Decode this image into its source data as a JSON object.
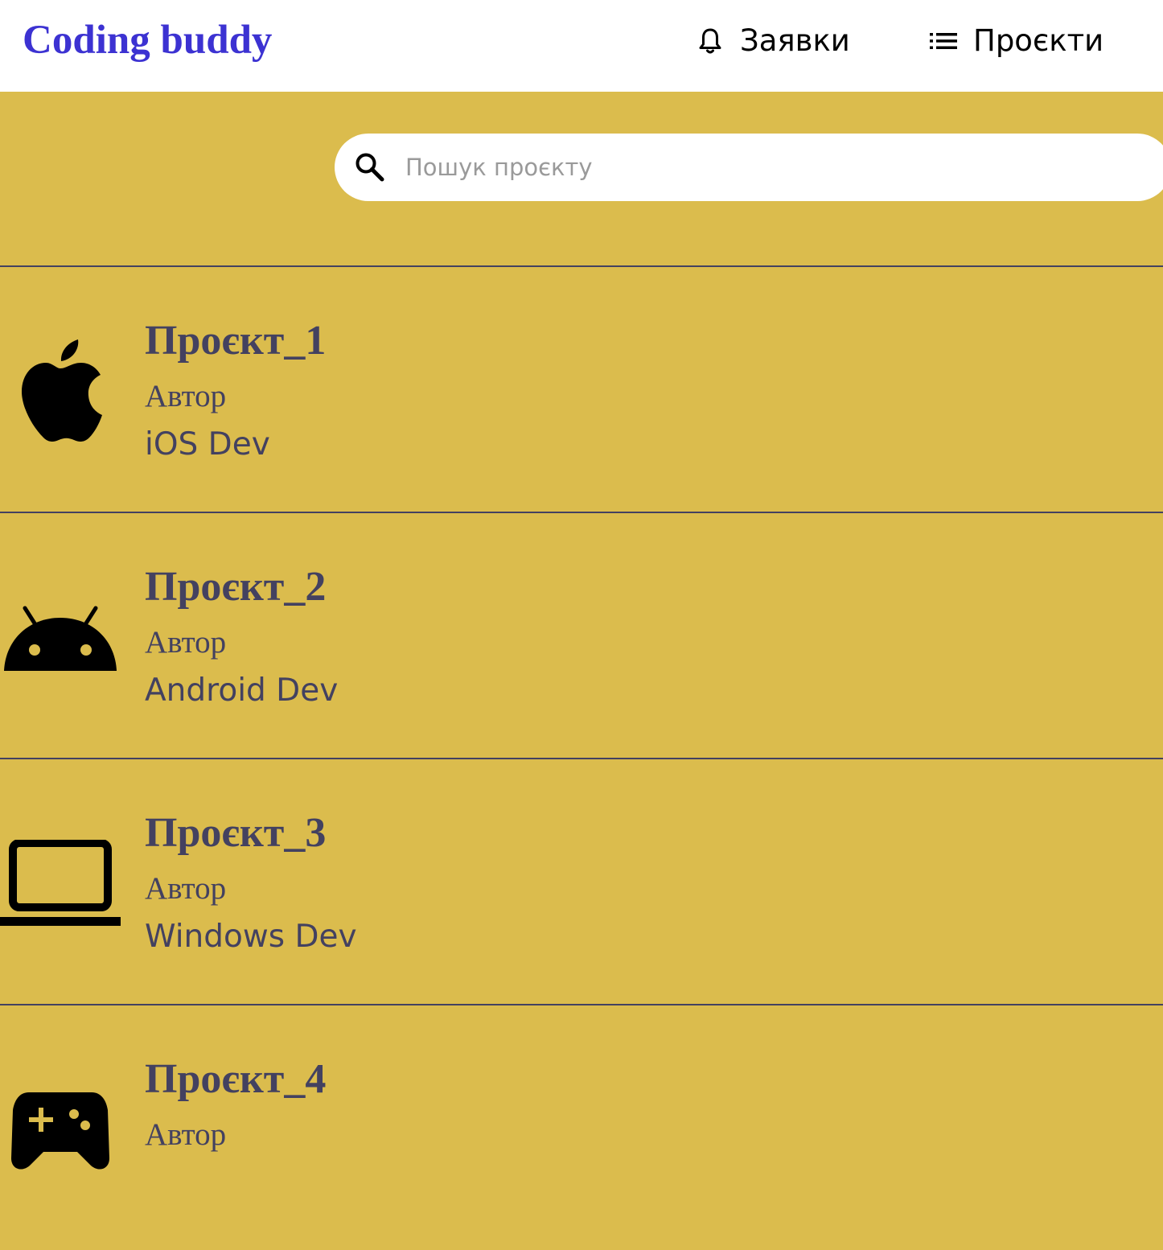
{
  "header": {
    "logo": "Coding buddy",
    "nav": {
      "requests": {
        "label": "Заявки",
        "icon": "bell-icon"
      },
      "projects": {
        "label": "Проєкти",
        "icon": "list-icon"
      }
    }
  },
  "search": {
    "placeholder": "Пошук проєкту",
    "value": "",
    "icon": "search-icon"
  },
  "projects": [
    {
      "title": "Проєкт_1",
      "author": "Автор",
      "platform": "iOS Dev",
      "icon": "apple-icon"
    },
    {
      "title": "Проєкт_2",
      "author": "Автор",
      "platform": "Android Dev",
      "icon": "android-icon"
    },
    {
      "title": "Проєкт_3",
      "author": "Автор",
      "platform": "Windows Dev",
      "icon": "laptop-icon"
    },
    {
      "title": "Проєкт_4",
      "author": "Автор",
      "platform": "",
      "icon": "gamepad-icon"
    }
  ],
  "colors": {
    "background": "#dbbc4d",
    "header_background": "#ffffff",
    "logo": "#3c32d2",
    "text": "#434160",
    "divider": "#434160"
  }
}
